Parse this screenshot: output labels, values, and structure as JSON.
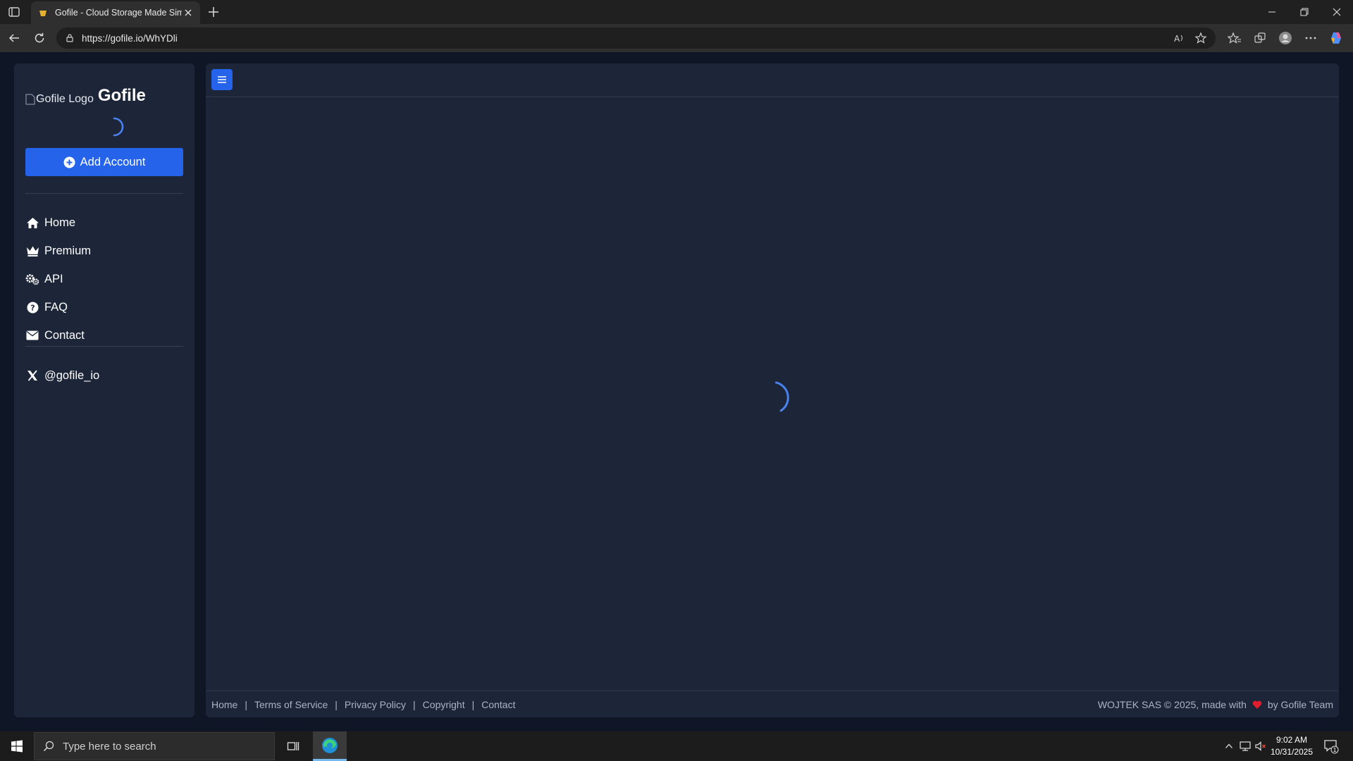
{
  "browser": {
    "tab_title": "Gofile - Cloud Storage Made Simple",
    "url": "https://gofile.io/WhYDli"
  },
  "sidebar": {
    "logo_alt": "Gofile Logo",
    "brand": "Gofile",
    "add_account": "Add Account",
    "nav": [
      {
        "label": "Home",
        "icon": "home-icon"
      },
      {
        "label": "Premium",
        "icon": "crown-icon"
      },
      {
        "label": "API",
        "icon": "gears-icon"
      },
      {
        "label": "FAQ",
        "icon": "question-circle-icon"
      },
      {
        "label": "Contact",
        "icon": "envelope-icon"
      }
    ],
    "social": {
      "label": "@gofile_io",
      "icon": "x-logo-icon"
    }
  },
  "footer": {
    "links": [
      "Home",
      "Terms of Service",
      "Privacy Policy",
      "Copyright",
      "Contact"
    ],
    "separator": "|",
    "copyright_prefix": "WOJTEK SAS © 2025, made with",
    "copyright_suffix": "by Gofile Team"
  },
  "taskbar": {
    "search_placeholder": "Type here to search",
    "time": "9:02 AM",
    "date": "10/31/2025",
    "notification_count": "1"
  },
  "colors": {
    "accent": "#2563eb",
    "panel": "#1d2638",
    "background": "#0f1625",
    "heart": "#e11d2e"
  }
}
